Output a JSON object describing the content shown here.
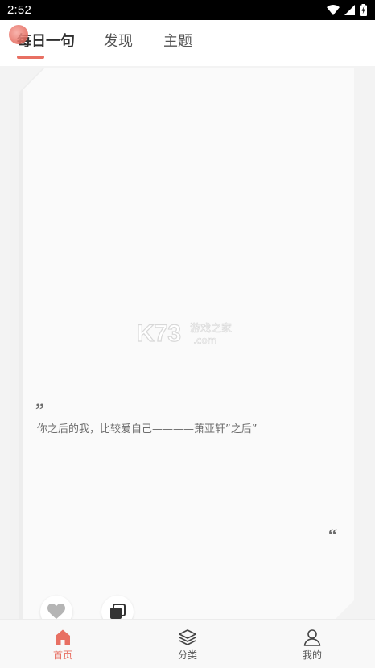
{
  "status_bar": {
    "time": "2:52",
    "icons": [
      "wifi-icon",
      "signal-icon",
      "battery-charging-icon"
    ]
  },
  "header": {
    "tabs": [
      {
        "label": "每日一句",
        "active": true
      },
      {
        "label": "发现",
        "active": false
      },
      {
        "label": "主题",
        "active": false
      }
    ]
  },
  "card": {
    "watermark": {
      "brand": "K73",
      "tagline": "游戏之家",
      "domain": ".com"
    },
    "quote_open": "”",
    "quote_text": "你之后的我，比较爱自己————萧亚轩”之后”",
    "quote_close": "“",
    "actions": [
      "heart-icon",
      "copy-icon"
    ]
  },
  "bottom_nav": {
    "items": [
      {
        "label": "首页",
        "icon": "home-icon",
        "active": true
      },
      {
        "label": "分类",
        "icon": "layers-icon",
        "active": false
      },
      {
        "label": "我的",
        "icon": "user-icon",
        "active": false
      }
    ]
  },
  "colors": {
    "accent": "#e87063",
    "status_bar": "#000000",
    "card_bg": "#fafafa",
    "text_muted": "#6d6d6d"
  }
}
